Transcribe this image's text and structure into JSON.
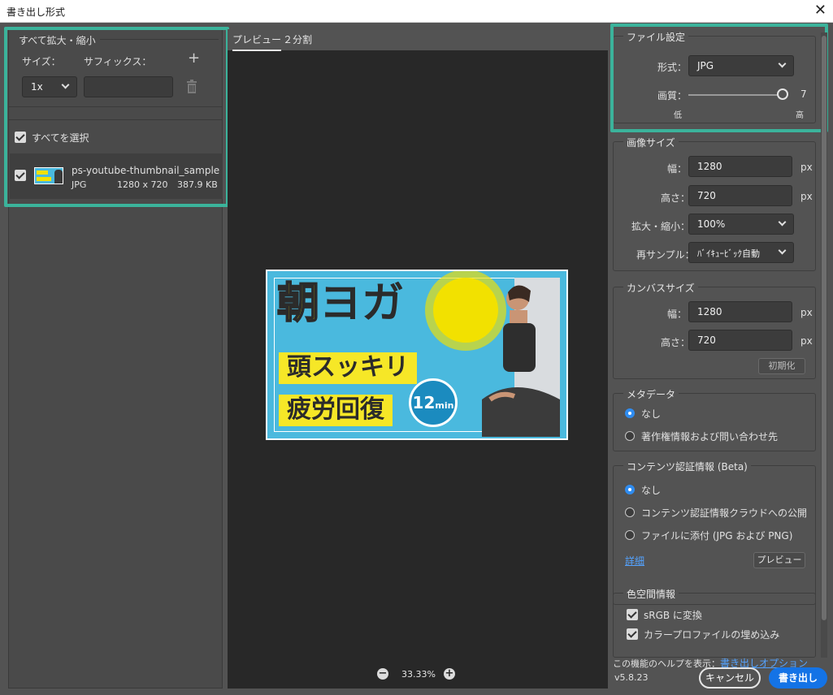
{
  "window": {
    "title": "書き出し形式",
    "close_glyph": "✕"
  },
  "left": {
    "group_title": "すべて拡大・縮小",
    "size_label": "サイズ：",
    "suffix_label": "サフィックス：",
    "add_glyph": "+",
    "scale_value": "1x",
    "suffix_value": "",
    "select_all_label": "すべてを選択",
    "file": {
      "name": "ps-youtube-thumbnail_sample",
      "format": "JPG",
      "dimensions": "1280 x 720",
      "size": "387.9 KB"
    }
  },
  "center": {
    "tabs": [
      {
        "label": "プレビュー",
        "active": true
      },
      {
        "label": "２分割",
        "active": false
      }
    ],
    "zoom": {
      "minus": "−",
      "value": "33.33%",
      "plus": "+"
    },
    "thumbnail": {
      "title_1": "朝",
      "title_2": "ヨガ",
      "band_1": "頭スッキリ",
      "band_2": "疲労回復",
      "badge_num": "12",
      "badge_unit": "min"
    }
  },
  "file_settings": {
    "title": "ファイル設定",
    "format_label": "形式：",
    "format_value": "JPG",
    "quality_label": "画質：",
    "quality_value": "7",
    "quality_fraction": 1.0,
    "low_label": "低",
    "high_label": "高"
  },
  "image_size": {
    "title": "画像サイズ",
    "width_label": "幅：",
    "width_value": "1280",
    "height_label": "高さ：",
    "height_value": "720",
    "unit": "px",
    "scale_label": "拡大・縮小：",
    "scale_value": "100%",
    "resample_label": "再サンプル：",
    "resample_value": "ﾊﾞｲｷｭｰﾋﾞｯｸ自動"
  },
  "canvas_size": {
    "title": "カンバスサイズ",
    "width_label": "幅：",
    "width_value": "1280",
    "height_label": "高さ：",
    "height_value": "720",
    "unit": "px",
    "reset_label": "初期化"
  },
  "metadata": {
    "title": "メタデータ",
    "options": [
      {
        "label": "なし",
        "selected": true
      },
      {
        "label": "著作権情報および問い合わせ先",
        "selected": false
      }
    ]
  },
  "content_credentials": {
    "title": "コンテンツ認証情報 (Beta)",
    "options": [
      {
        "label": "なし",
        "selected": true
      },
      {
        "label": "コンテンツ認証情報クラウドへの公開",
        "selected": false
      },
      {
        "label": "ファイルに添付 (JPG および PNG)",
        "selected": false
      }
    ],
    "details_link": "詳細",
    "preview_button": "プレビュー"
  },
  "color_space": {
    "title": "色空間情報",
    "convert_srgb": "sRGB に変換",
    "embed_profile": "カラープロファイルの埋め込み"
  },
  "footer": {
    "help_text": "この機能のヘルプを表示：",
    "help_link": "書き出しオプション",
    "version": "v5.8.23",
    "cancel": "キャンセル",
    "export": "書き出し"
  },
  "colors": {
    "highlight": "#3bb39b",
    "accent": "#1473e6",
    "radio_on": "#2f8cf0"
  }
}
